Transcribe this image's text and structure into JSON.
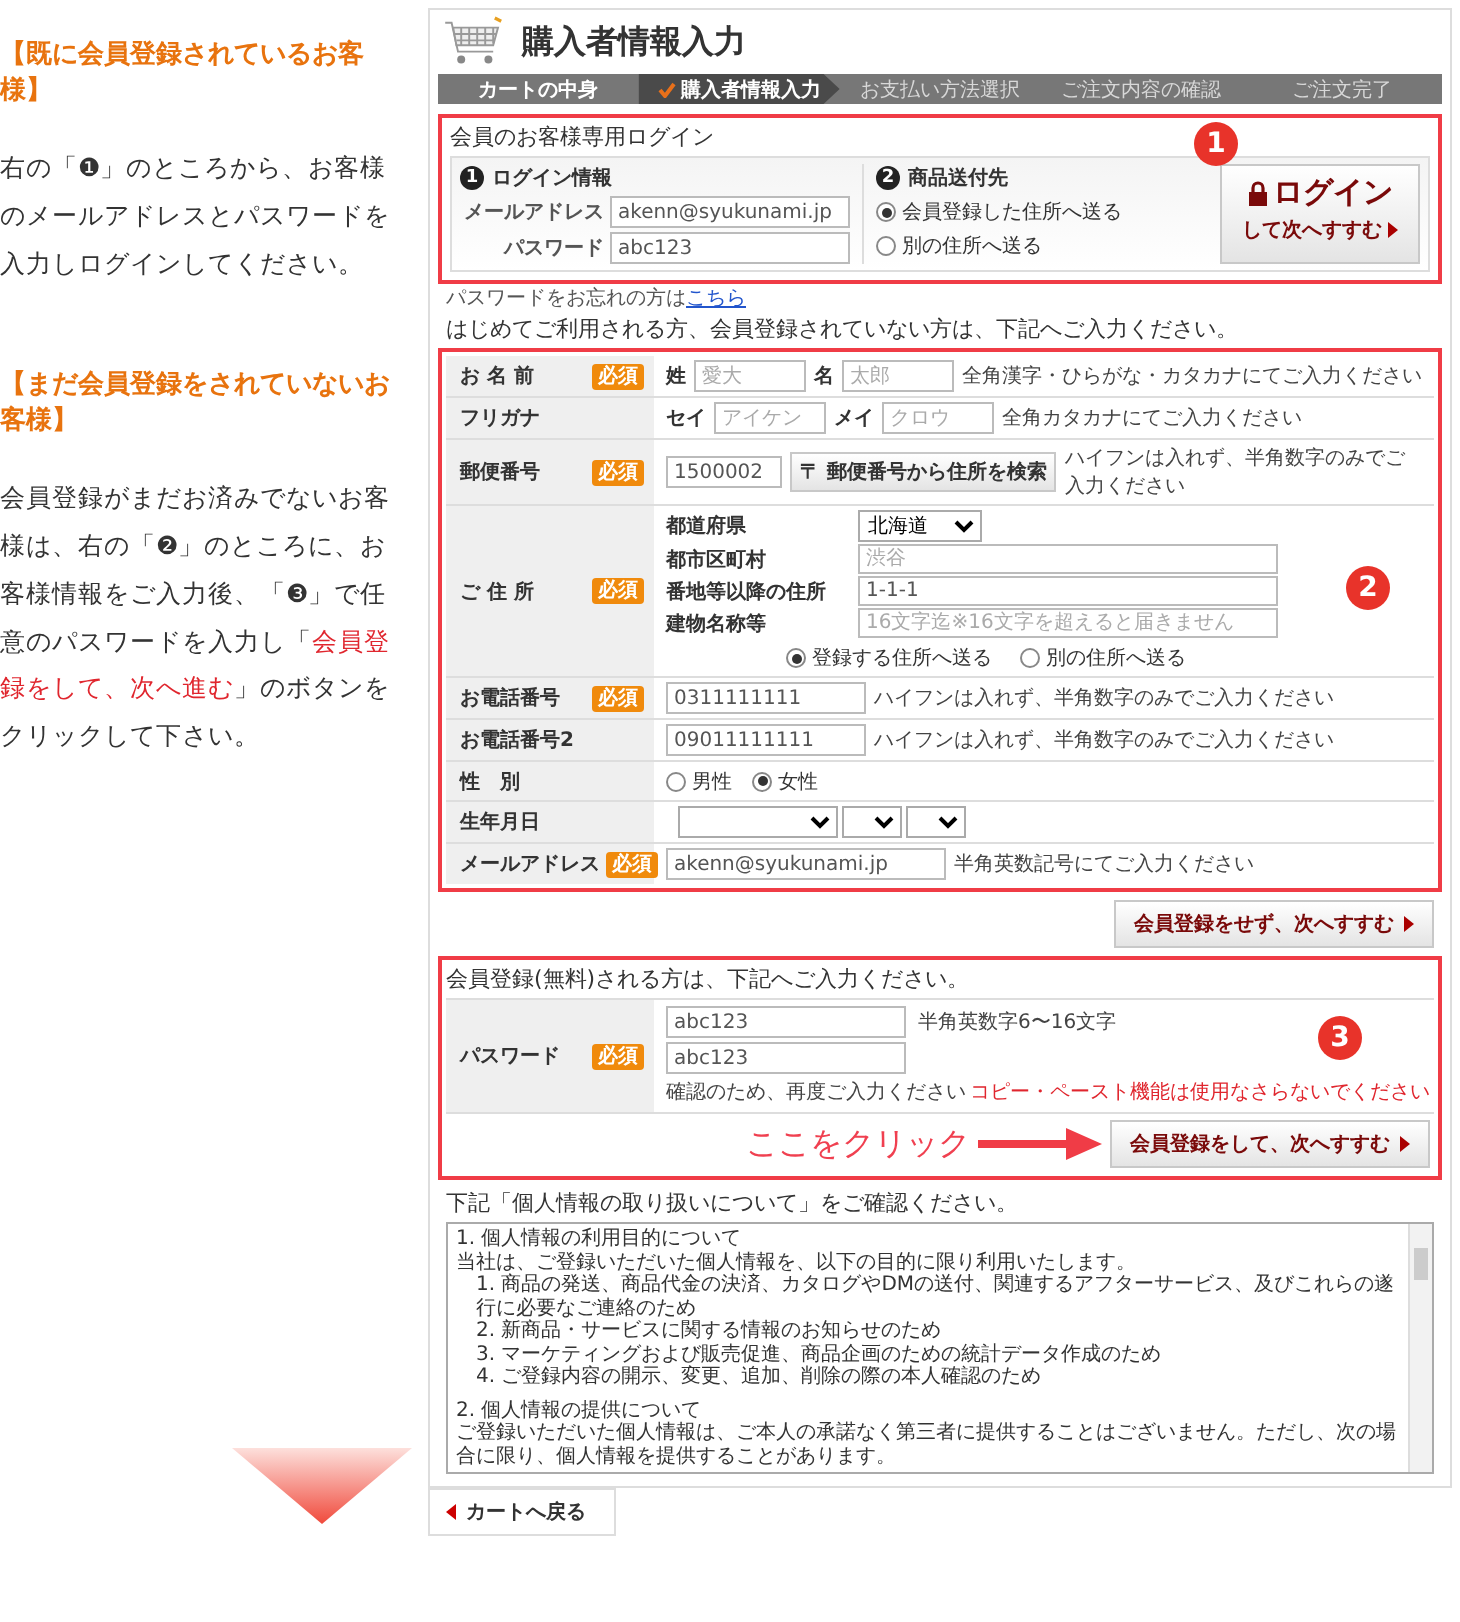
{
  "guide": {
    "sections": [
      {
        "heading": "【既に会員登録されているお客様】",
        "paragraph": [
          {
            "text": "右の「❶」のところから、お客様のメールアドレスとパスワードを入力しログインしてください。",
            "highlight": false
          }
        ]
      },
      {
        "heading": "【まだ会員登録をされていないお客様】",
        "paragraph": [
          {
            "text": "会員登録がまだお済みでないお客様は、右の「❷」のところに、お客様情報をご入力後、「❸」で任意のパスワードを入力し「",
            "highlight": false
          },
          {
            "text": "会員登録をして、次へ進む",
            "highlight": true
          },
          {
            "text": "」のボタンをクリックして下さい。",
            "highlight": false
          }
        ]
      }
    ]
  },
  "panel": {
    "title": "購入者情報入力",
    "steps": [
      {
        "label": "カートの中身",
        "selected": false,
        "done": true
      },
      {
        "label": "購入者情報入力",
        "selected": true,
        "done": false
      },
      {
        "label": "お支払い方法選択",
        "selected": false,
        "done": false
      },
      {
        "label": "ご注文内容の確認",
        "selected": false,
        "done": false
      },
      {
        "label": "ご注文完了",
        "selected": false,
        "done": false
      }
    ],
    "login": {
      "title": "会員のお客様専用ログイン",
      "badge": "1",
      "info_heading": {
        "number": "1",
        "label": "ログイン情報"
      },
      "fields": [
        {
          "label": "メールアドレス",
          "value": "akenn@syukunami.jp"
        },
        {
          "label": "パスワード",
          "value": "abc123"
        }
      ],
      "ship_heading": {
        "number": "2",
        "label": "商品送付先"
      },
      "ship_options": [
        {
          "label": "会員登録した住所へ送る",
          "selected": true
        },
        {
          "label": "別の住所へ送る",
          "selected": false
        }
      ],
      "button": {
        "label": "ログイン",
        "sub": "して次へすすむ"
      }
    },
    "forgot": {
      "text": "パスワードをお忘れの方は",
      "link": "こちら"
    },
    "intro": "はじめてご利用される方、会員登録されていない方は、下記へご入力ください。",
    "form": {
      "badge": "2",
      "rows": [
        {
          "kind": "name",
          "label": "お 名 前",
          "required_badge": "必須",
          "parts": [
            {
              "label": "姓",
              "placeholder": "愛大"
            },
            {
              "label": "名",
              "placeholder": "太郎"
            }
          ],
          "hint": "全角漢字・ひらがな・カタカナにてご入力ください"
        },
        {
          "kind": "name",
          "label": "フリガナ",
          "parts": [
            {
              "label": "セイ",
              "placeholder": "アイケン"
            },
            {
              "label": "メイ",
              "placeholder": "クロウ"
            }
          ],
          "hint": "全角カタカナにてご入力ください"
        },
        {
          "kind": "zip",
          "label": "郵便番号",
          "required_badge": "必須",
          "value": "1500002",
          "button": "〒 郵便番号から住所を検索",
          "hint": "ハイフンは入れず、半角数字のみでご入力ください"
        },
        {
          "kind": "address",
          "label": "ご 住 所",
          "required_badge": "必須",
          "prefecture": {
            "label": "都道府県",
            "value": "北海道"
          },
          "lines": [
            {
              "label": "都市区町村",
              "placeholder": "渋谷"
            },
            {
              "label": "番地等以降の住所",
              "value": "1-1-1"
            },
            {
              "label": "建物名称等",
              "placeholder": "16文字迄※16文字を超えると届きません"
            }
          ],
          "options": [
            {
              "label": "登録する住所へ送る",
              "selected": true
            },
            {
              "label": "別の住所へ送る",
              "selected": false
            }
          ]
        },
        {
          "kind": "text",
          "label": "お電話番号",
          "required_badge": "必須",
          "value": "0311111111",
          "hint": "ハイフンは入れず、半角数字のみでご入力ください"
        },
        {
          "kind": "text",
          "label": "お電話番号2",
          "value": "09011111111",
          "hint": "ハイフンは入れず、半角数字のみでご入力ください"
        },
        {
          "kind": "gender",
          "label": "性　別",
          "options": [
            {
              "label": "男性",
              "selected": false
            },
            {
              "label": "女性",
              "selected": true
            }
          ]
        },
        {
          "kind": "birthdate",
          "label": "生年月日"
        },
        {
          "kind": "text",
          "label": "メールアドレス",
          "required_badge": "必須",
          "value": "akenn@syukunami.jp",
          "hint": "半角英数記号にてご入力ください"
        }
      ]
    },
    "skip_button": "会員登録をせず、次へすすむ",
    "register": {
      "title": "会員登録(無料)される方は、下記へご入力ください。",
      "badge": "3",
      "label": "パスワード",
      "required_badge": "必須",
      "password": "abc123",
      "hint": "半角英数字6〜16文字",
      "confirm": "abc123",
      "confirm_note": "確認のため、再度ご入力ください",
      "warning": "コピー・ペースト機能は使用なさらないでください",
      "callout": "ここをクリック",
      "button": "会員登録をして、次へすすむ"
    },
    "policy": {
      "title": "下記「個人情報の取り扱いについて」をご確認ください。",
      "lines": [
        {
          "kind": "heading",
          "text": "1. 個人情報の利用目的について"
        },
        {
          "kind": "text",
          "text": "当社は、ご登録いただいた個人情報を、以下の目的に限り利用いたします。"
        },
        {
          "kind": "item",
          "text": "1. 商品の発送、商品代金の決済、カタログやDMの送付、関連するアフターサービス、及びこれらの遂行に必要なご連絡のため"
        },
        {
          "kind": "item",
          "text": "2. 新商品・サービスに関する情報のお知らせのため"
        },
        {
          "kind": "item",
          "text": "3. マーケティングおよび販売促進、商品企画のための統計データ作成のため"
        },
        {
          "kind": "item",
          "text": "4. ご登録内容の開示、変更、追加、削除の際の本人確認のため"
        },
        {
          "kind": "heading",
          "text": "2. 個人情報の提供について"
        },
        {
          "kind": "text",
          "text": "ご登録いただいた個人情報は、ご本人の承諾なく第三者に提供することはございません。ただし、次の場合に限り、個人情報を提供することがあります。"
        }
      ]
    },
    "back_button": "カートへ戻る"
  }
}
